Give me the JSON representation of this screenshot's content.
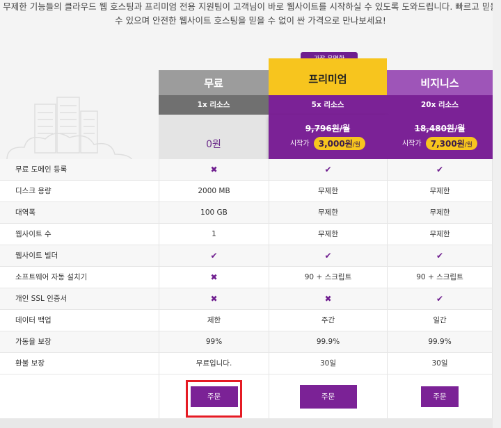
{
  "intro": {
    "line1": "무제한 기능들의 클라우드 웹 호스팅과 프리미엄 전용 지원팀이 고객님이 바로 웹사이트를 시작하실 수 있도록 도와드립니다. 빠르고 믿을",
    "line2": "수 있으며 안전한 웹사이트 호스팅을 믿을 수 없이 싼 가격으로 만나보세요!"
  },
  "badge": "가장 유명한",
  "plans": {
    "free": {
      "name": "무료",
      "resources": "1x 리소스",
      "price": "0원",
      "order": "주문"
    },
    "premium": {
      "name": "프리미엄",
      "resources": "5x 리소스",
      "original": "9,796원/월",
      "start_label": "시작가",
      "price": "3,000원",
      "per": "/월",
      "order": "주문"
    },
    "business": {
      "name": "비지니스",
      "resources": "20x 리소스",
      "original": "18,480원/월",
      "start_label": "시작가",
      "price": "7,300원",
      "per": "/월",
      "order": "주문"
    }
  },
  "features": [
    {
      "label": "무료 도메인 등록",
      "free": "✖",
      "premium": "✔",
      "business": "✔"
    },
    {
      "label": "디스크 용량",
      "free": "2000 MB",
      "premium": "무제한",
      "business": "무제한"
    },
    {
      "label": "대역폭",
      "free": "100 GB",
      "premium": "무제한",
      "business": "무제한"
    },
    {
      "label": "웹사이트 수",
      "free": "1",
      "premium": "무제한",
      "business": "무제한"
    },
    {
      "label": "웹사이트 빌더",
      "free": "✔",
      "premium": "✔",
      "business": "✔"
    },
    {
      "label": "소프트웨어 자동 설치기",
      "free": "✖",
      "premium": "90 + 스크립트",
      "business": "90 + 스크립트"
    },
    {
      "label": "개인 SSL 인증서",
      "free": "✖",
      "premium": "✖",
      "business": "✔"
    },
    {
      "label": "데이터 백업",
      "free": "제한",
      "premium": "주간",
      "business": "일간"
    },
    {
      "label": "가동율 보장",
      "free": "99%",
      "premium": "99.9%",
      "business": "99.9%"
    },
    {
      "label": "환불 보장",
      "free": "무료입니다.",
      "premium": "30일",
      "business": "30일"
    }
  ],
  "colors": {
    "accent": "#7b2296",
    "premium_header": "#f7c51e",
    "highlight": "#e51b24"
  }
}
